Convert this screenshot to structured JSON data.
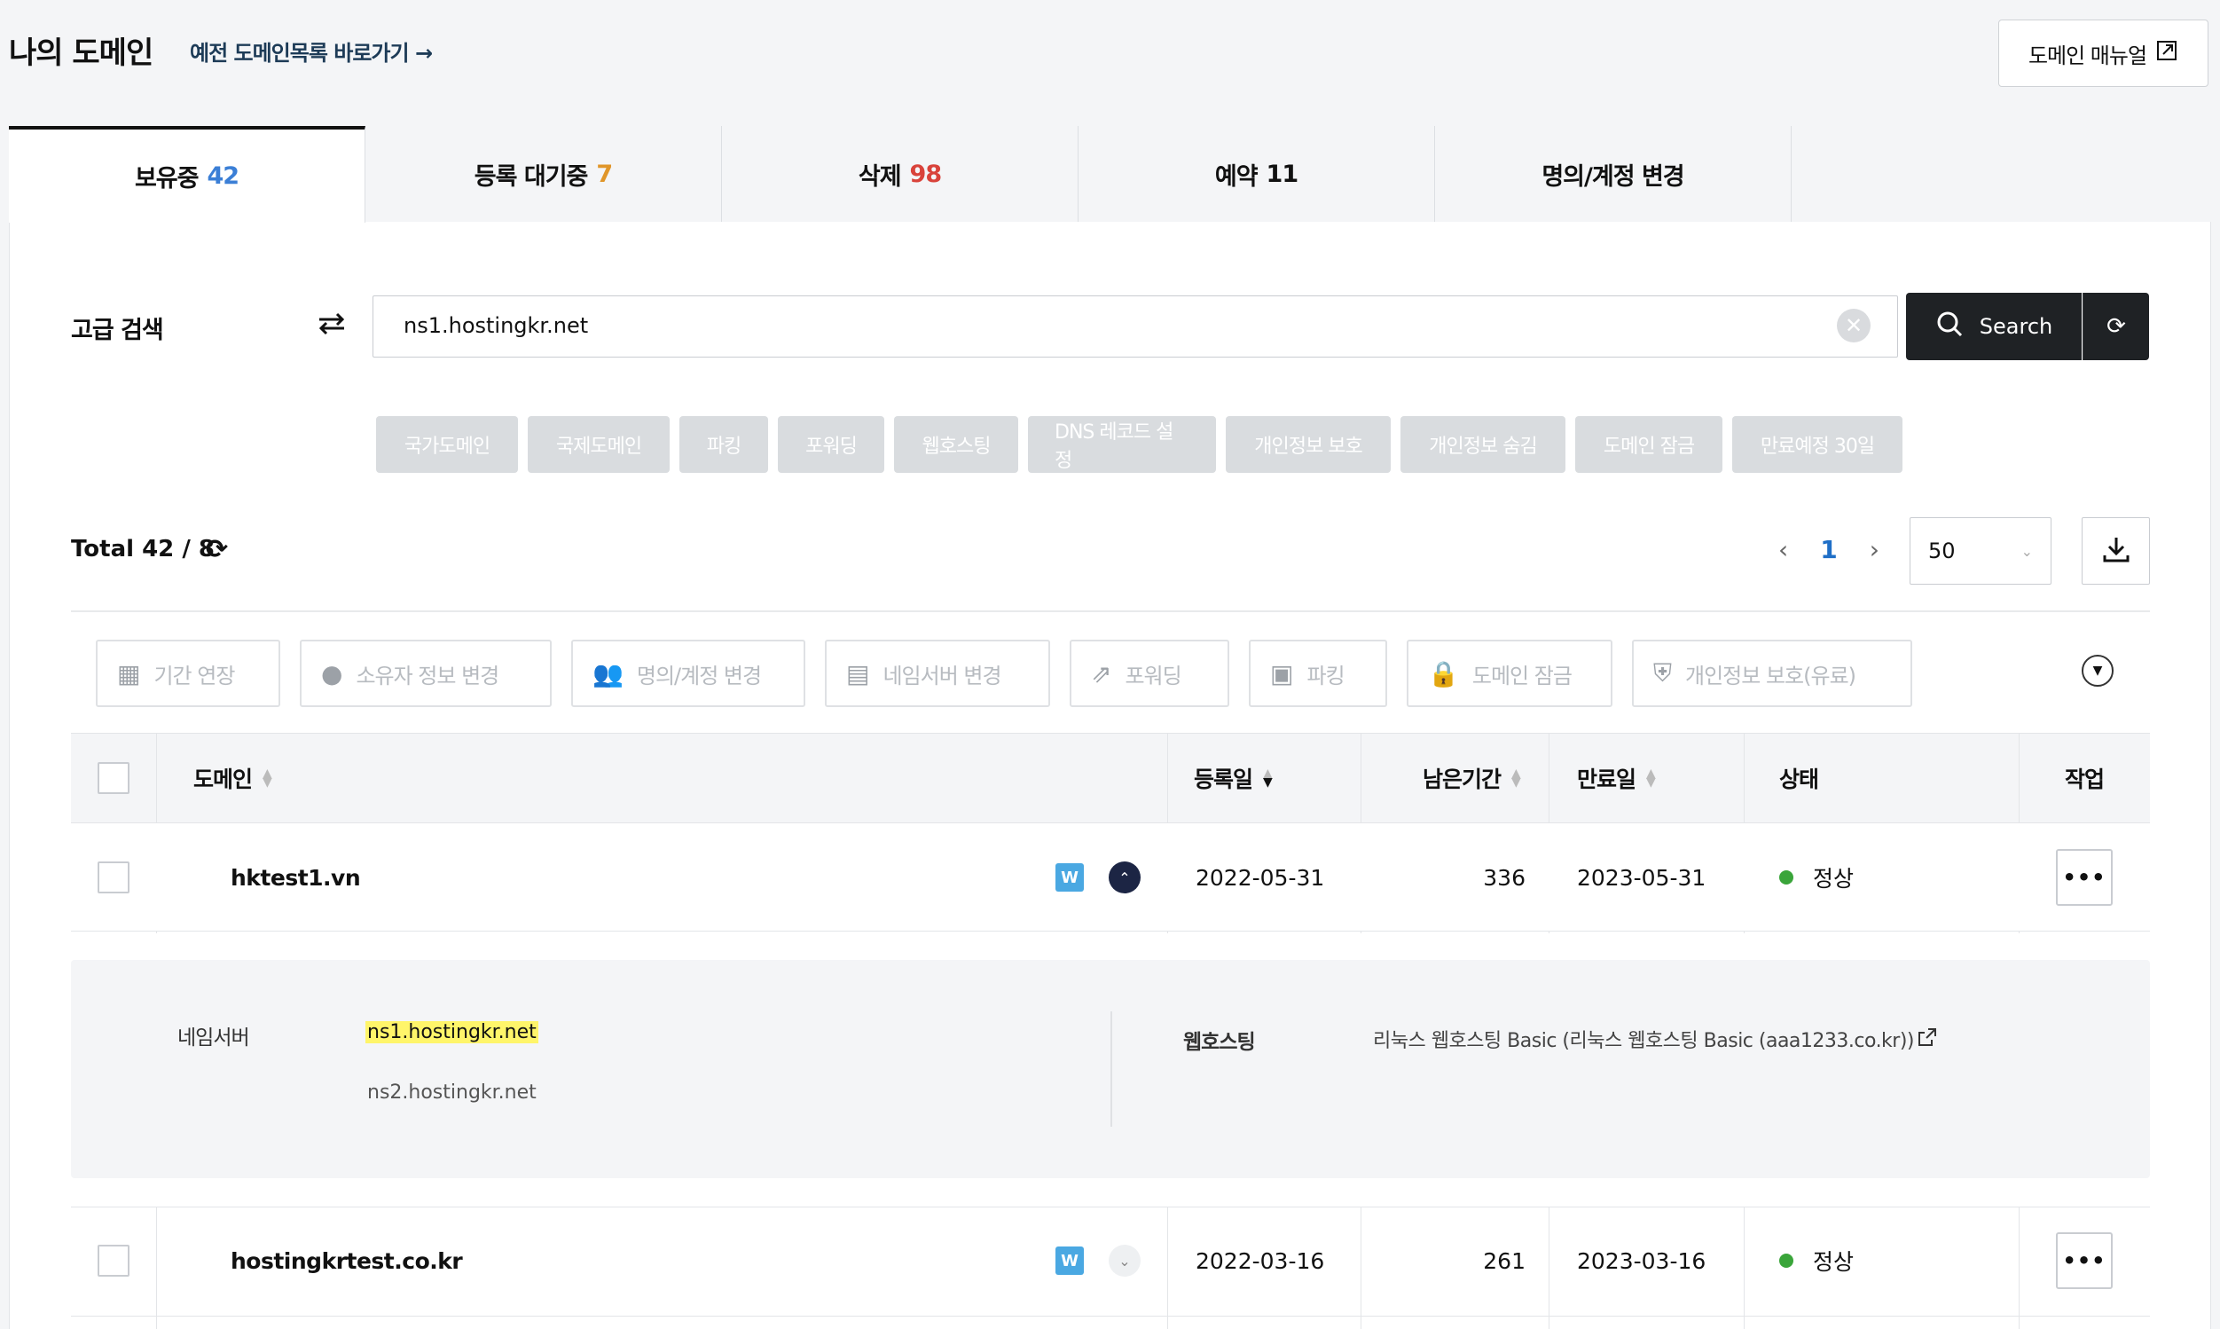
{
  "header": {
    "title": "나의 도메인",
    "old_list_link": "예전 도메인목록 바로가기 →",
    "manual_button": "도메인 매뉴얼"
  },
  "tabs": [
    {
      "label": "보유중",
      "count": "42",
      "count_color": "#3b7fd6",
      "active": true
    },
    {
      "label": "등록 대기중",
      "count": "7",
      "count_color": "#e0962a",
      "active": false
    },
    {
      "label": "삭제",
      "count": "98",
      "count_color": "#d9433b",
      "active": false
    },
    {
      "label": "예약",
      "count": "11",
      "count_color": "#111111",
      "active": false
    },
    {
      "label": "명의/계정 변경",
      "count": "",
      "count_color": "#111111",
      "active": false
    }
  ],
  "search": {
    "label": "고급 검색",
    "value": "ns1.hostingkr.net",
    "button": "Search"
  },
  "filters": [
    "국가도메인",
    "국제도메인",
    "파킹",
    "포워딩",
    "웹호스팅",
    "DNS 레코드 설정",
    "개인정보 보호",
    "개인정보 숨김",
    "도메인 잠금",
    "만료예정 30일"
  ],
  "summary": {
    "total": "Total 42 / 8",
    "page": "1",
    "page_size": "50"
  },
  "actions": [
    {
      "label": "기간 연장",
      "icon": "calendar-icon"
    },
    {
      "label": "소유자 정보 변경",
      "icon": "user-icon"
    },
    {
      "label": "명의/계정 변경",
      "icon": "users-icon"
    },
    {
      "label": "네임서버 변경",
      "icon": "server-icon"
    },
    {
      "label": "포워딩",
      "icon": "forward-icon"
    },
    {
      "label": "파킹",
      "icon": "image-icon"
    },
    {
      "label": "도메인 잠금",
      "icon": "lock-icon"
    },
    {
      "label": "개인정보 보호(유료)",
      "icon": "shield-icon"
    }
  ],
  "table": {
    "headers": {
      "domain": "도메인",
      "registered": "등록일",
      "remaining": "남은기간",
      "expires": "만료일",
      "status": "상태",
      "action": "작업"
    },
    "rows": [
      {
        "domain": "hktest1.vn",
        "badge": "W",
        "registered": "2022-05-31",
        "remaining": "336",
        "expires": "2023-05-31",
        "status": "정상",
        "status_color": "#3aa53a",
        "expanded": true
      },
      {
        "domain": "hostingkrtest.co.kr",
        "badge": "W",
        "registered": "2022-03-16",
        "remaining": "261",
        "expires": "2023-03-16",
        "status": "정상",
        "status_color": "#3aa53a",
        "expanded": false
      }
    ]
  },
  "detail": {
    "nameserver_label": "네임서버",
    "nameservers": [
      "ns1.hostingkr.net",
      "ns2.hostingkr.net"
    ],
    "hosting_label": "웹호스팅",
    "hosting_value": "리눅스 웹호스팅 Basic (리눅스 웹호스팅 Basic (aaa1233.co.kr))"
  }
}
